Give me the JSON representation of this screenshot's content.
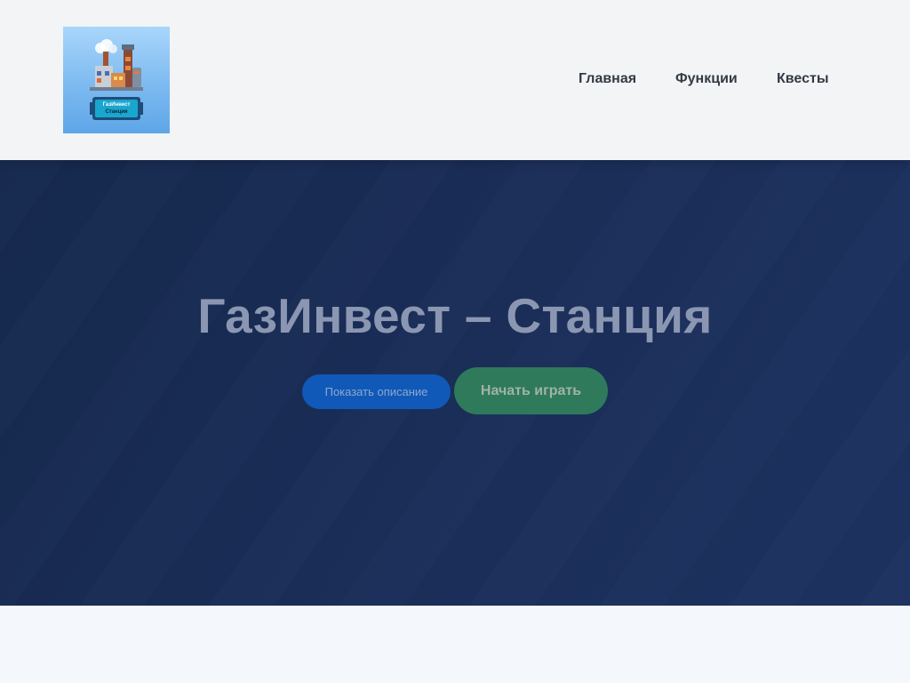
{
  "header": {
    "logo": {
      "line1": "ГазИнвест",
      "line2": "Станция",
      "icon": "gas-station-factory-logo"
    },
    "nav": [
      {
        "label": "Главная"
      },
      {
        "label": "Функции"
      },
      {
        "label": "Квесты"
      }
    ]
  },
  "hero": {
    "title": "ГазИнвест – Станция",
    "show_description_label": "Показать описание",
    "start_game_label": "Начать играть"
  },
  "colors": {
    "header_bg": "#f3f4f6",
    "hero_bg": "#1a2e58",
    "description_button": "#1059b8",
    "play_button": "#2f7a5a",
    "hero_title": "#8b97b2"
  }
}
